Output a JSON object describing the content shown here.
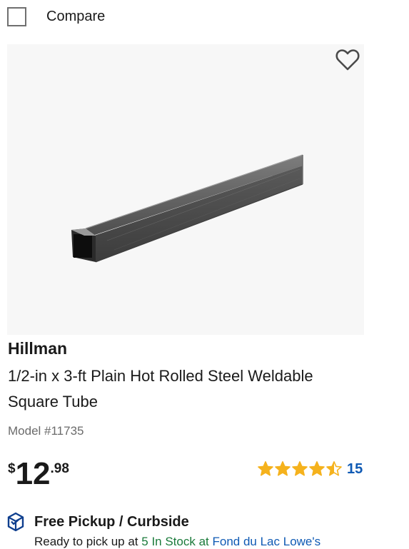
{
  "compare": {
    "label": "Compare",
    "checked": false
  },
  "product": {
    "brand": "Hillman",
    "title": "1/2-in x 3-ft Plain Hot Rolled Steel Weldable Square Tube",
    "model": "Model #11735",
    "image_alt": "Steel square tube",
    "price": {
      "currency": "$",
      "dollars": "12",
      "cents": ".98"
    },
    "rating": {
      "value": 4.5,
      "max": 5,
      "count": "15"
    }
  },
  "fulfillment": {
    "label": "Free Pickup / Curbside",
    "ready_text": "Ready to pick up at",
    "stock_text": "5 In Stock at",
    "store_text": "Fond du Lac Lowe's"
  },
  "colors": {
    "star": "#f5b21d",
    "link": "#0f5ab4",
    "in_stock": "#1a7a3a",
    "icon": "#0f3f8e"
  },
  "icons": {
    "favorite": "heart-outline-icon",
    "pickup": "pickup-box-icon",
    "star": "star-icon"
  }
}
